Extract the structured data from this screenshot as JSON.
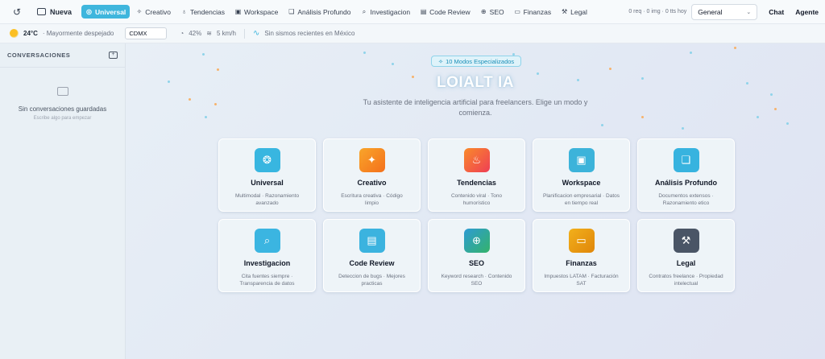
{
  "topbar": {
    "new_label": "Nueva",
    "tabs": [
      {
        "label": "Universal",
        "icon": "brain-icon",
        "glyph": "◎",
        "active": true
      },
      {
        "label": "Creativo",
        "icon": "sparkles-icon",
        "glyph": "✧"
      },
      {
        "label": "Tendencias",
        "icon": "flame-icon",
        "glyph": "♁"
      },
      {
        "label": "Workspace",
        "icon": "briefcase-icon",
        "glyph": "▣"
      },
      {
        "label": "Análisis Profundo",
        "icon": "book-icon",
        "glyph": "❑"
      },
      {
        "label": "Investigacion",
        "icon": "search-icon",
        "glyph": "⌕"
      },
      {
        "label": "Code Review",
        "icon": "code-file-icon",
        "glyph": "▤"
      },
      {
        "label": "SEO",
        "icon": "globe-icon",
        "glyph": "⊕"
      },
      {
        "label": "Finanzas",
        "icon": "banknote-icon",
        "glyph": "▭"
      },
      {
        "label": "Legal",
        "icon": "gavel-icon",
        "glyph": "⚒"
      }
    ],
    "stats": "0 req · 0 img · 0 tts hoy",
    "select_value": "General",
    "chat_label": "Chat",
    "agent_label": "Agente"
  },
  "weather": {
    "temp": "24°C",
    "condition": "· Mayormente despejado",
    "city": "CDMX",
    "humidity": "42%",
    "wind": "5 km/h",
    "seismic": "Sin sismos recientes en México"
  },
  "sidebar": {
    "title": "CONVERSACIONES",
    "empty_title": "Sin conversaciones guardadas",
    "empty_hint": "Escribe algo para empezar"
  },
  "hero": {
    "badge": "10 Modos Especializados",
    "brand": "LOIALT IA",
    "tagline": "Tu asistente de inteligencia artificial para freelancers. Elige un modo y comienza."
  },
  "cards": [
    {
      "title": "Universal",
      "desc": "Multimodal · Razonamiento avanzado",
      "color": "#38b6e0",
      "glyph": "❂"
    },
    {
      "title": "Creativo",
      "desc": "Escritura creativa · Código limpio",
      "color": "#f7841f",
      "glyph": "✦"
    },
    {
      "title": "Tendencias",
      "desc": "Contenido viral · Tono humorístico",
      "color": "#f2513d",
      "glyph": "♨"
    },
    {
      "title": "Workspace",
      "desc": "Planificacion empresarial · Datos en tiempo real",
      "color": "#3cb3da",
      "glyph": "▣"
    },
    {
      "title": "Análisis Profundo",
      "desc": "Documentos extensos · Razonamiento etico",
      "color": "#37b3df",
      "glyph": "❑"
    },
    {
      "title": "Investigacion",
      "desc": "Cita fuentes siempre · Transparencia de datos",
      "color": "#3bb5e1",
      "glyph": "⌕"
    },
    {
      "title": "Code Review",
      "desc": "Deteccion de bugs · Mejores practicas",
      "color": "#3bb3df",
      "glyph": "▤"
    },
    {
      "title": "SEO",
      "desc": "Keyword research · Contenido SEO",
      "color": "#2fa37c",
      "glyph": "⊕"
    },
    {
      "title": "Finanzas",
      "desc": "Impuestos LATAM · Facturación SAT",
      "color": "#eb9c12",
      "glyph": "▭"
    },
    {
      "title": "Legal",
      "desc": "Contratos freelance · Propiedad intelectual",
      "color": "#4a5566",
      "glyph": "⚒"
    }
  ]
}
